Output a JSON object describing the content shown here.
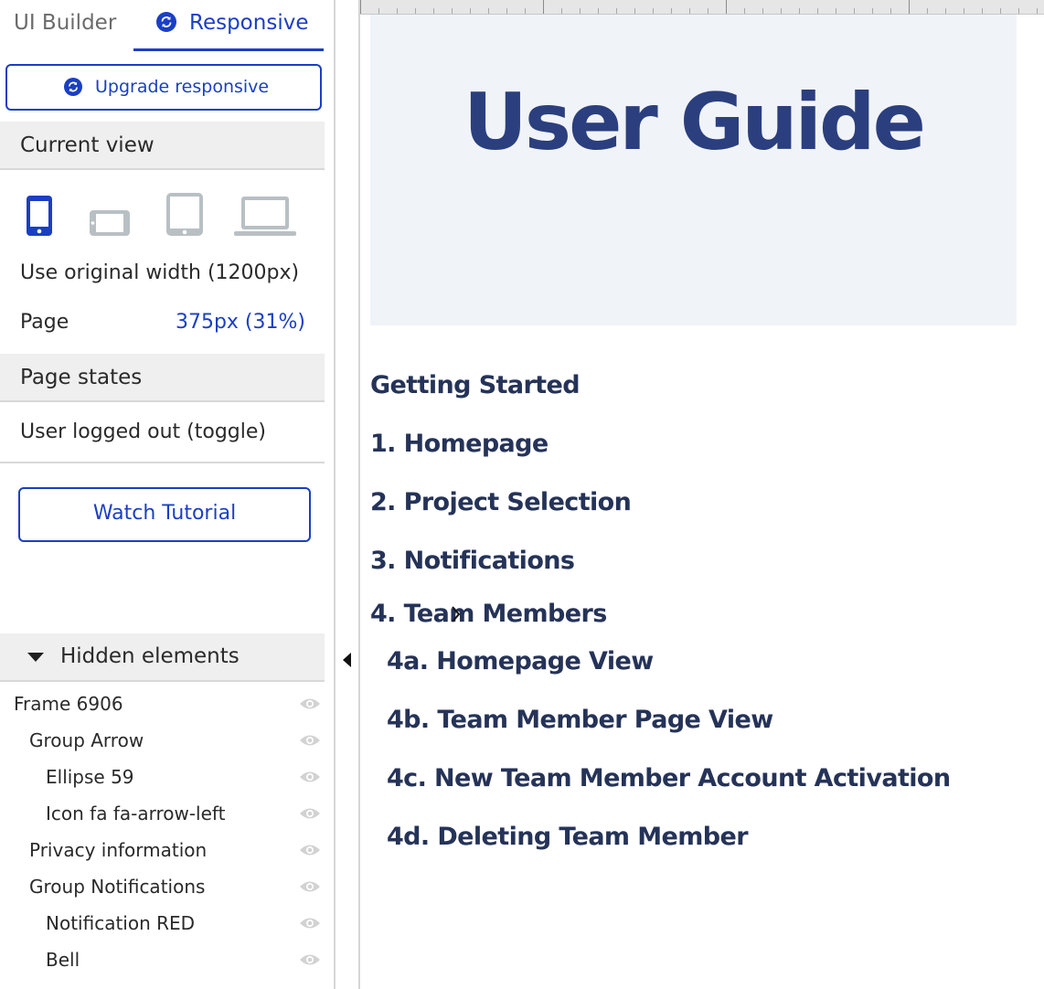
{
  "tabs": {
    "ui_builder": "UI Builder",
    "responsive": "Responsive"
  },
  "upgrade_button": "Upgrade responsive",
  "current_view": {
    "title": "Current view",
    "use_original_width": "Use original width (1200px)",
    "page_label": "Page",
    "page_value": "375px (31%)"
  },
  "page_states": {
    "title": "Page states",
    "state": "User logged out (toggle)"
  },
  "watch_tutorial": "Watch Tutorial",
  "hidden_elements": {
    "title": "Hidden elements",
    "items": [
      {
        "label": "Frame 6906"
      },
      {
        "label": "Group Arrow"
      },
      {
        "label": "Ellipse 59"
      },
      {
        "label": "Icon fa fa-arrow-left"
      },
      {
        "label": "Privacy information"
      },
      {
        "label": "Group Notifications"
      },
      {
        "label": "Notification RED"
      },
      {
        "label": "Bell"
      }
    ]
  },
  "canvas": {
    "hero_title": "User Guide",
    "toc": [
      "Getting Started",
      "1. Homepage",
      "2. Project Selection",
      "3. Notifications",
      "4. Team Members",
      "4a. Homepage View",
      "4b. Team Member Page View",
      "4c. New Team Member Account Activation",
      "4d. Deleting Team Member"
    ]
  },
  "colors": {
    "accent": "#1a3fc4",
    "hero_bg": "#f0f3f8",
    "hero_title": "#2b3f7e",
    "toc_text": "#253358",
    "inactive_icon": "#b8c0c4"
  },
  "icons": {
    "tab_responsive": "sync-icon",
    "devices": [
      "phone-icon",
      "phone-landscape-icon",
      "tablet-icon",
      "laptop-icon"
    ],
    "visibility": "eye-icon",
    "collapse": "caret-left-icon"
  }
}
